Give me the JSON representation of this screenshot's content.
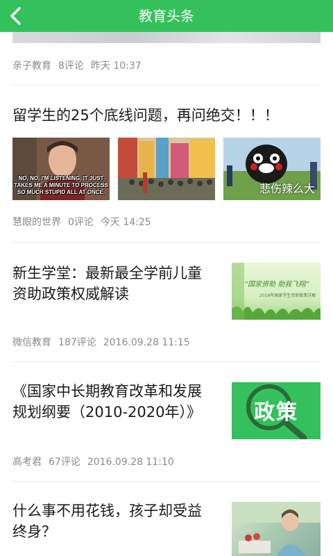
{
  "header": {
    "title": "教育头条",
    "back_icon": "chevron-left-icon"
  },
  "colors": {
    "accent": "#34c15b",
    "meta": "#8a8a8a",
    "text": "#1a1a1a"
  },
  "articles": [
    {
      "source": "亲子教育",
      "comments": "8评论",
      "time": "昨天 10:37"
    },
    {
      "title": "留学生的25个底线问题，再问绝交！！！",
      "source": "慧眼的世界",
      "comments": "0评论",
      "time": "今天 14:25",
      "meme_text": "NO, NO, I'M LISTENING. IT JUST TAKES ME A MINUTE TO PROCESS SO MUCH STUPID ALL AT ONCE.",
      "image_caption": "悲伤辣么大"
    },
    {
      "title": "新生学堂：最新最全学前儿童资助政策权威解读",
      "source": "微信教育",
      "comments": "187评论",
      "time": "2016.09.28 11:15",
      "thumb_text": "“国家资助 助我飞翔”",
      "thumb_sub": "2016年国家学生资助政策详解"
    },
    {
      "title": "《国家中长期教育改革和发展规划纲要（2010-2020年）》",
      "source": "高考君",
      "comments": "67评论",
      "time": "2016.09.28 11:10",
      "thumb_text": "政策"
    },
    {
      "title": "什么事不用花钱，孩子却受益终身？"
    }
  ]
}
